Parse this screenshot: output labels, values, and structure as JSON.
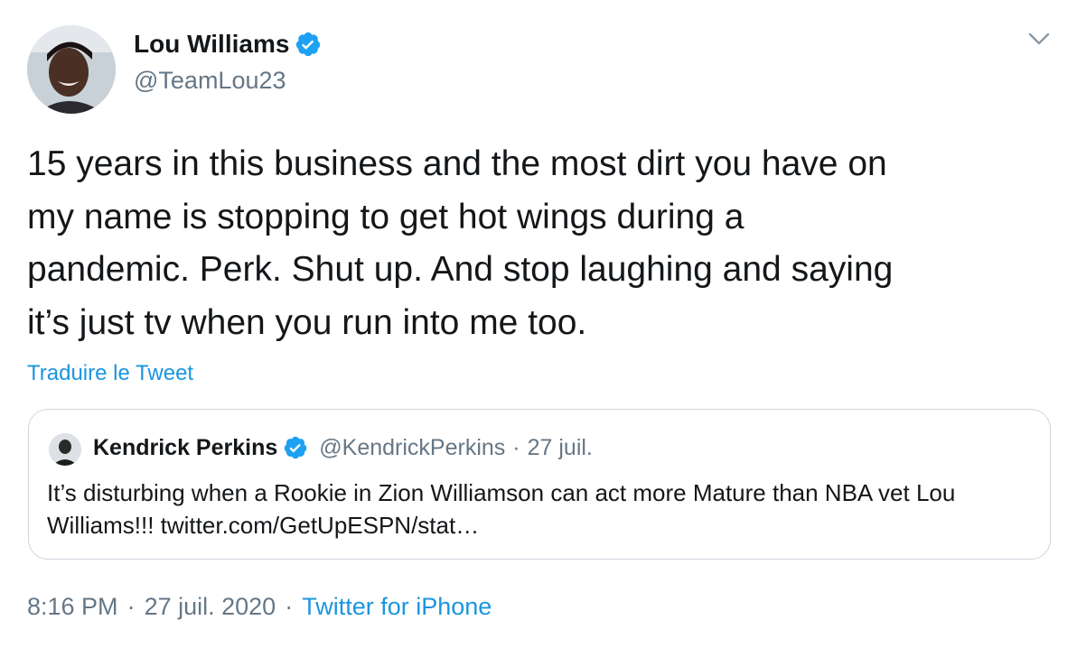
{
  "tweet": {
    "author": {
      "name": "Lou Williams",
      "handle": "@TeamLou23",
      "verified": true
    },
    "text": "15 years in this business and the most dirt you have on\nmy name is stopping to get hot wings during a\npandemic. Perk. Shut up. And stop laughing and saying\nit’s just tv when you run into me too.",
    "translate_label": "Traduire le Tweet",
    "quote": {
      "name": "Kendrick Perkins",
      "handle": "@KendrickPerkins",
      "separator": "·",
      "date": "27 juil.",
      "text": "It’s disturbing when a Rookie in Zion Williamson can act more Mature than NBA vet Lou Williams!!! twitter.com/GetUpESPN/stat…"
    },
    "footer": {
      "time": "8:16 PM",
      "sep1": "·",
      "date": "27 juil. 2020",
      "sep2": "·",
      "source": "Twitter for iPhone"
    }
  },
  "colors": {
    "text": "#14171a",
    "secondary": "#657786",
    "link": "#1b95e0",
    "border": "#ccd6dd",
    "verified": "#1da1f2"
  },
  "icons": {
    "verified": "verified-badge-icon",
    "menu": "chevron-down-icon"
  }
}
